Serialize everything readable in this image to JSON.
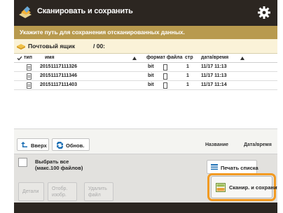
{
  "titlebar": {
    "title": "Сканировать и сохранить",
    "icon": "scan-and-store-icon",
    "settings_icon": "gear-icon"
  },
  "prompt": {
    "text": "Укажите путь для сохранения отсканированных данных."
  },
  "path": {
    "label": "Почтовый ящик",
    "value": "/ 00:"
  },
  "columns": {
    "type": "тип",
    "name": "имя",
    "format": "формат файла",
    "pages": "стр",
    "date": "дата/время"
  },
  "files": [
    {
      "name": "20151117111326",
      "format": "bit",
      "pages": "1",
      "datetime": "11/17 11:13"
    },
    {
      "name": "20151117111346",
      "format": "bit",
      "pages": "1",
      "datetime": "11/17 11:13"
    },
    {
      "name": "20151117111403",
      "format": "bit",
      "pages": "1",
      "datetime": "11/17 11:14"
    }
  ],
  "toolbar": {
    "back_label": "Вверх",
    "refresh_label": "Обнов.",
    "sort_name": "Название",
    "sort_date": "Дата/время"
  },
  "lower": {
    "select_all_line1": "Выбрать все",
    "select_all_line2": "(макс.100 файлов)",
    "print_list_label": "Печать списка",
    "details_label": "Детали",
    "edit_line1": "Отобр.",
    "edit_line2": "изобр.",
    "delete_line1": "Удалить",
    "delete_line2": "файл",
    "scan_label": "Сканир. и сохранить",
    "accent_color": "#f29a21"
  }
}
